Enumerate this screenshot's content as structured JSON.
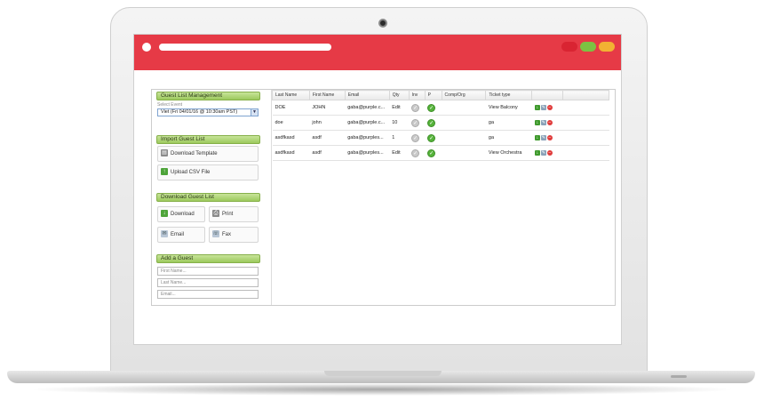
{
  "sidebar": {
    "guest_list_header": "Guest List Management",
    "select_event_label": "Select Event",
    "event_value": "Viet (Fri 04/01/16 @ 10:30am PST)",
    "import_header": "Import Guest List",
    "download_template_label": "Download Template",
    "upload_csv_label": "Upload CSV File",
    "download_header": "Download Guest List",
    "download_label": "Download",
    "print_label": "Print",
    "email_label": "Email",
    "fax_label": "Fax",
    "add_guest_header": "Add a Guest",
    "first_name_placeholder": "First Name...",
    "last_name_placeholder": "Last Name...",
    "email_placeholder": "Email..."
  },
  "table": {
    "columns": [
      "Last Name",
      "First Name",
      "Email",
      "Qty",
      "Inv",
      "P",
      "Comp/Org",
      "Ticket type",
      ""
    ],
    "rows": [
      {
        "last": "DOE",
        "first": "JOHN",
        "email": "gaba@purple.c...",
        "qty": "Edit",
        "ticket": "View Balcony"
      },
      {
        "last": "doe",
        "first": "john",
        "email": "gaba@purple.c...",
        "qty": "10",
        "ticket": "ga"
      },
      {
        "last": "asdfkasd",
        "first": "asdf",
        "email": "gaba@purples...",
        "qty": "1",
        "ticket": "ga"
      },
      {
        "last": "asdfkasd",
        "first": "asdf",
        "email": "gaba@purples...",
        "qty": "Edit",
        "ticket": "View Orchestra"
      }
    ]
  },
  "colors": {
    "browser_bar": "#e63a46",
    "section_header": "#9cc95c",
    "link": "#2b63c6"
  }
}
